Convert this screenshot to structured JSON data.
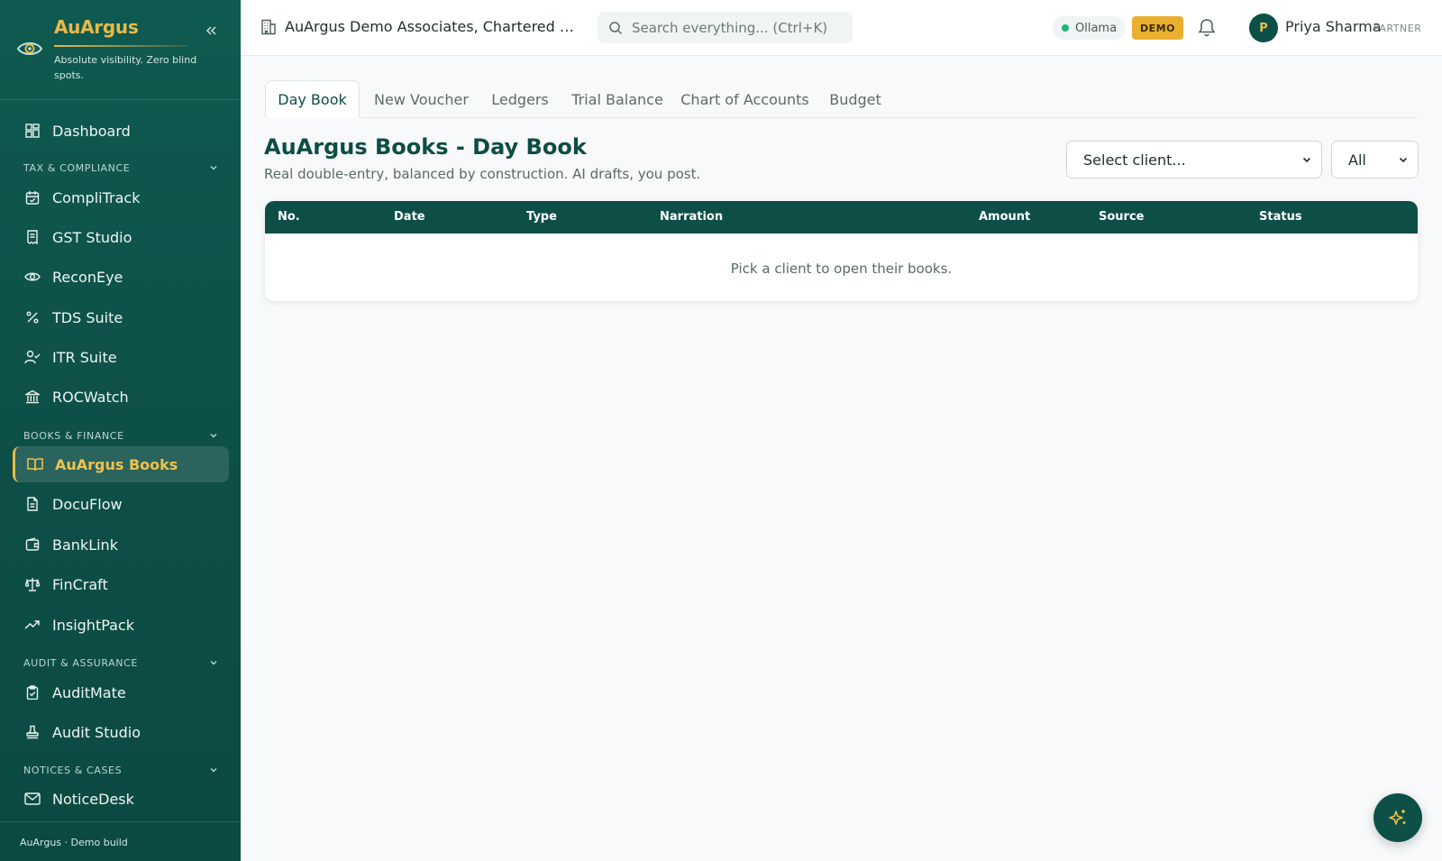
{
  "brand": {
    "name": "AuArgus",
    "tagline": "Absolute visibility. Zero blind spots."
  },
  "sidebar": {
    "top_items": [
      {
        "label": "Dashboard",
        "icon": "dashboard-icon"
      }
    ],
    "sections": [
      {
        "title": "TAX & COMPLIANCE",
        "items": [
          {
            "label": "CompliTrack",
            "icon": "calendar-check-icon"
          },
          {
            "label": "GST Studio",
            "icon": "receipt-icon"
          },
          {
            "label": "ReconEye",
            "icon": "eye-icon"
          },
          {
            "label": "TDS Suite",
            "icon": "percent-icon"
          },
          {
            "label": "ITR Suite",
            "icon": "user-check-icon"
          },
          {
            "label": "ROCWatch",
            "icon": "bank-building-icon"
          }
        ]
      },
      {
        "title": "BOOKS & FINANCE",
        "items": [
          {
            "label": "AuArgus Books",
            "icon": "book-open-icon",
            "active": true
          },
          {
            "label": "DocuFlow",
            "icon": "document-icon"
          },
          {
            "label": "BankLink",
            "icon": "wallet-icon"
          },
          {
            "label": "FinCraft",
            "icon": "scale-icon"
          },
          {
            "label": "InsightPack",
            "icon": "trending-up-icon"
          }
        ]
      },
      {
        "title": "AUDIT & ASSURANCE",
        "items": [
          {
            "label": "AuditMate",
            "icon": "clipboard-check-icon"
          },
          {
            "label": "Audit Studio",
            "icon": "stamp-icon"
          }
        ]
      },
      {
        "title": "NOTICES & CASES",
        "items": [
          {
            "label": "NoticeDesk",
            "icon": "mail-icon"
          }
        ]
      }
    ],
    "footer": "AuArgus · Demo build"
  },
  "topbar": {
    "org_name": "AuArgus Demo Associates, Chartered Accou...",
    "search_placeholder": "Search everything...  (Ctrl+K)",
    "status_label": "Ollama",
    "status_color": "#1fb577",
    "demo_badge": "DEMO",
    "user": {
      "initial": "P",
      "name": "Priya Sharma",
      "role": "PARTNER"
    }
  },
  "tabs": [
    "Day Book",
    "New Voucher",
    "Ledgers",
    "Trial Balance",
    "Chart of Accounts",
    "Budget"
  ],
  "page": {
    "title": "AuArgus Books - Day Book",
    "subtitle": "Real double-entry, balanced by construction. AI drafts, you post."
  },
  "filters": {
    "client_select": "Select client...",
    "type_select": "All"
  },
  "table": {
    "columns": [
      "No.",
      "Date",
      "Type",
      "Narration",
      "Amount",
      "Source",
      "Status"
    ],
    "empty_message": "Pick a client to open their books."
  },
  "colors": {
    "brand_green": "#0d4f47",
    "accent_gold": "#e9b949"
  }
}
